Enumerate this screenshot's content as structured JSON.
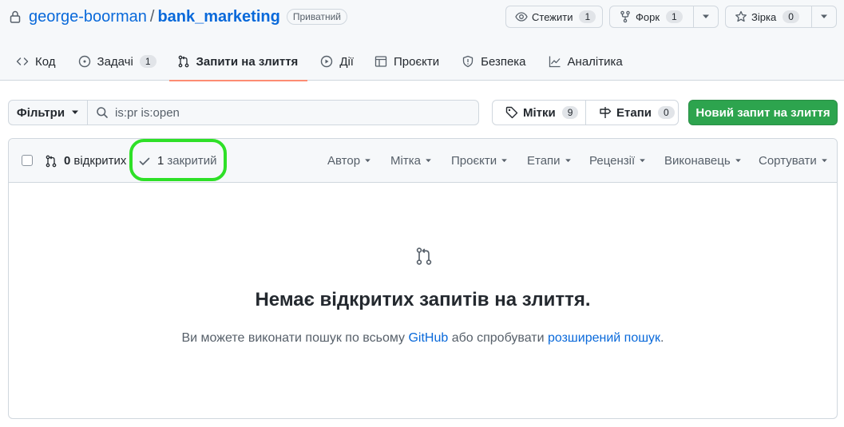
{
  "repo": {
    "owner": "george-boorman",
    "separator": "/",
    "name": "bank_marketing",
    "visibility": "Приватний"
  },
  "header_actions": {
    "watch": {
      "label": "Стежити",
      "count": "1"
    },
    "fork": {
      "label": "Форк",
      "count": "1"
    },
    "star": {
      "label": "Зірка",
      "count": "0"
    }
  },
  "tabs": [
    {
      "label": "Код",
      "icon": "code-icon"
    },
    {
      "label": "Задачі",
      "icon": "issue-opened-icon",
      "count": "1"
    },
    {
      "label": "Запити на злиття",
      "icon": "git-pull-request-icon",
      "active": true
    },
    {
      "label": "Дії",
      "icon": "play-icon"
    },
    {
      "label": "Проєкти",
      "icon": "table-icon"
    },
    {
      "label": "Безпека",
      "icon": "shield-icon"
    },
    {
      "label": "Аналітика",
      "icon": "graph-icon"
    }
  ],
  "filter_bar": {
    "filters_label": "Фільтри",
    "search_value": "is:pr is:open",
    "labels_label": "Мітки",
    "labels_count": "9",
    "milestones_label": "Етапи",
    "milestones_count": "0",
    "new_pr_label": "Новий запит на злиття"
  },
  "list_header": {
    "open_count": "0",
    "open_label": "відкритих",
    "closed_count": "1",
    "closed_label": "закритий",
    "menus": [
      "Автор",
      "Мітка",
      "Проєкти",
      "Етапи",
      "Рецензії",
      "Виконавець",
      "Сортувати"
    ]
  },
  "blankslate": {
    "title": "Немає відкритих запитів на злиття.",
    "text_before": "Ви можете виконати пошук по всьому ",
    "link1": "GitHub",
    "text_middle": " або спробувати ",
    "link2": "розширений пошук",
    "text_after": "."
  },
  "colors": {
    "link": "#0969da",
    "primary_button": "#2da44e",
    "active_tab_underline": "#fd8c73",
    "highlight_ring": "#2ee027"
  }
}
